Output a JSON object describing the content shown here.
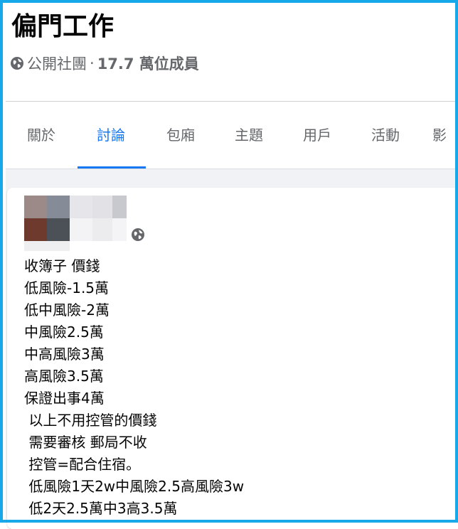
{
  "group": {
    "name": "偏門工作",
    "privacy": "公開社團",
    "separator": "·",
    "member_count": "17.7 萬位成員"
  },
  "tabs": [
    {
      "label": "關於",
      "active": false
    },
    {
      "label": "討論",
      "active": true
    },
    {
      "label": "包廂",
      "active": false
    },
    {
      "label": "主題",
      "active": false
    },
    {
      "label": "用戶",
      "active": false
    },
    {
      "label": "活動",
      "active": false
    },
    {
      "label": "影",
      "active": false
    }
  ],
  "post": {
    "audience_icon": "globe-icon",
    "lines": [
      "收簿子 價錢",
      "低風險-1.5萬",
      "低中風險-2萬",
      "中風險2.5萬",
      "中高風險3萬",
      "高風險3.5萬",
      "保證出事4萬",
      " 以上不用控管的價錢",
      " 需要審核 郵局不收",
      " 控管=配合住宿。",
      " 低風險1天2w中風險2.5高風險3w",
      " 低2天2.5萬中3高3.5萬"
    ]
  },
  "colors": {
    "frame_border": "#16a8e8",
    "accent": "#1877f2",
    "secondary_text": "#65676b",
    "feed_background": "#f0f2f5"
  }
}
